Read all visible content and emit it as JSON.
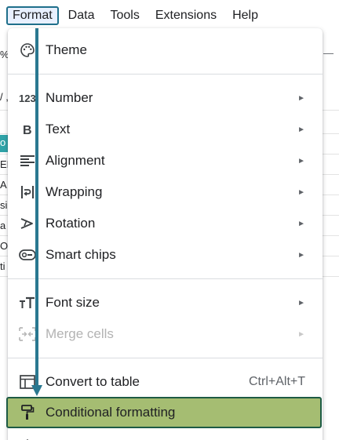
{
  "menubar": {
    "items": [
      {
        "label": "Format",
        "active": true
      },
      {
        "label": "Data"
      },
      {
        "label": "Tools"
      },
      {
        "label": "Extensions"
      },
      {
        "label": "Help"
      }
    ]
  },
  "background": {
    "left_fragments": [
      "%",
      "/ ,",
      "o",
      "EF",
      "A",
      "si",
      "a",
      "OI",
      "ti"
    ],
    "right_fragments": [
      "—"
    ]
  },
  "format_menu": {
    "items": [
      {
        "label": "Theme",
        "icon": "palette-icon"
      },
      {
        "label": "Number",
        "icon": "number-123-icon",
        "submenu": true
      },
      {
        "label": "Text",
        "icon": "bold-icon",
        "submenu": true
      },
      {
        "label": "Alignment",
        "icon": "align-left-icon",
        "submenu": true
      },
      {
        "label": "Wrapping",
        "icon": "wrap-text-icon",
        "submenu": true
      },
      {
        "label": "Rotation",
        "icon": "text-rotation-icon",
        "submenu": true
      },
      {
        "label": "Smart chips",
        "icon": "smart-chip-icon",
        "submenu": true
      },
      {
        "label": "Font size",
        "icon": "font-size-icon",
        "submenu": true
      },
      {
        "label": "Merge cells",
        "icon": "merge-cells-icon",
        "submenu": true,
        "disabled": true
      },
      {
        "label": "Convert to table",
        "icon": "table-icon",
        "shortcut": "Ctrl+Alt+T"
      },
      {
        "label": "Conditional formatting",
        "icon": "paint-roller-icon",
        "highlighted": true
      }
    ],
    "submenu_arrow": "►"
  },
  "colors": {
    "highlight_fill": "#a5bd72",
    "highlight_border": "#1e5b45",
    "annotation_arrow": "#2a7890",
    "active_menu_border": "#1f6f8b"
  }
}
